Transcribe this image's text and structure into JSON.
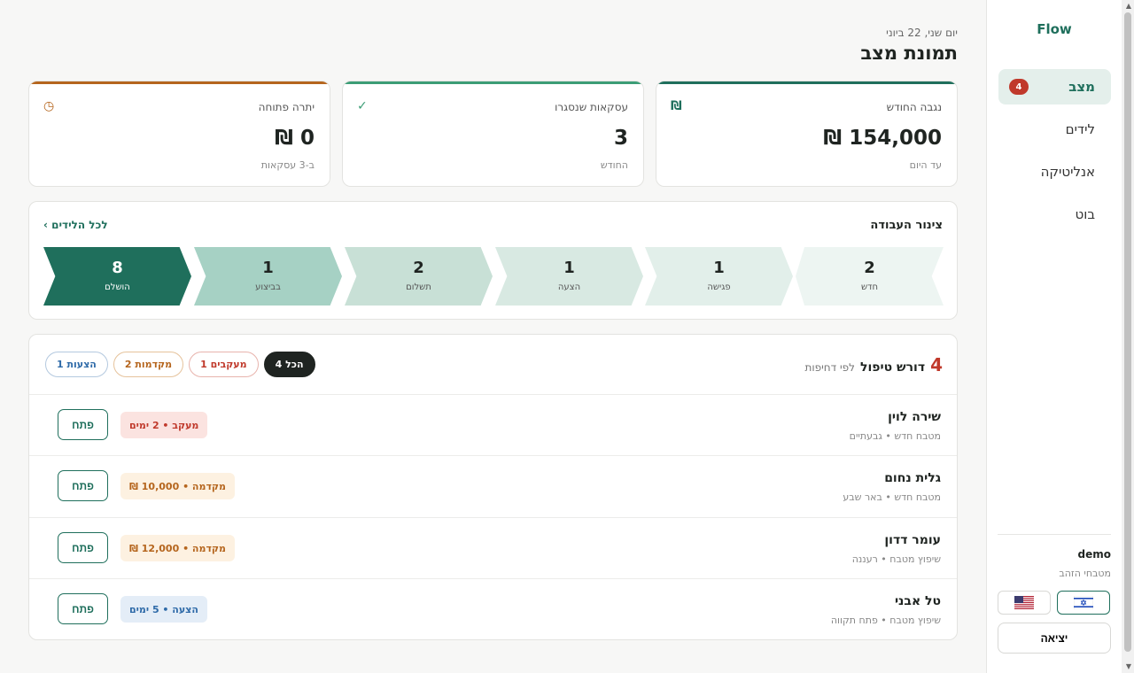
{
  "sidebar": {
    "brand": "Flow",
    "nav": [
      {
        "label": "מצב",
        "badge": "4"
      },
      {
        "label": "לידים"
      },
      {
        "label": "אנליטיקה"
      },
      {
        "label": "בוט"
      }
    ],
    "user": {
      "name": "demo",
      "business": "מטבחי הזהב"
    },
    "logout": "יציאה"
  },
  "header": {
    "date": "יום שני, 22 ביוני",
    "title": "תמונת מצב"
  },
  "kpis": [
    {
      "label": "נגבה החודש",
      "value": "154,000 ₪",
      "sub": "עד היום",
      "icon": "₪"
    },
    {
      "label": "עסקאות שנסגרו",
      "value": "3",
      "sub": "החודש",
      "icon": "✓"
    },
    {
      "label": "יתרה פתוחה",
      "value": "0 ₪",
      "sub": "ב-3 עסקאות",
      "icon": "◷"
    }
  ],
  "pipeline": {
    "title": "צינור העבודה",
    "link": "לכל הלידים ›",
    "stages": [
      {
        "count": "2",
        "label": "חדש"
      },
      {
        "count": "1",
        "label": "פגישה"
      },
      {
        "count": "1",
        "label": "הצעה"
      },
      {
        "count": "2",
        "label": "תשלום"
      },
      {
        "count": "1",
        "label": "בביצוע"
      },
      {
        "count": "8",
        "label": "הושלם"
      }
    ]
  },
  "tasks": {
    "count": "4",
    "title": "דורש טיפול",
    "subtitle": "לפי דחיפות",
    "filters": {
      "all": "הכל 4",
      "delay": "מעקבים 1",
      "adv": "מקדמות 2",
      "prop": "הצעות 1"
    },
    "rows": [
      {
        "name": "שירה לוין",
        "meta": "מטבח חדש • גבעתיים",
        "tag": "מעקב • 2 ימים",
        "action": "פתח"
      },
      {
        "name": "גלית נחום",
        "meta": "מטבח חדש • באר שבע",
        "tag": "מקדמה • 10,000 ₪",
        "action": "פתח"
      },
      {
        "name": "עומר דדון",
        "meta": "שיפוץ מטבח • רעננה",
        "tag": "מקדמה • 12,000 ₪",
        "action": "פתח"
      },
      {
        "name": "טל אבני",
        "meta": "שיפוץ מטבח • פתח תקווה",
        "tag": "הצעה • 5 ימים",
        "action": "פתח"
      }
    ]
  },
  "colors": {
    "accent": "#1f6f5c",
    "danger": "#c0392b",
    "warning": "#b5651d",
    "info": "#2e6aa8"
  }
}
